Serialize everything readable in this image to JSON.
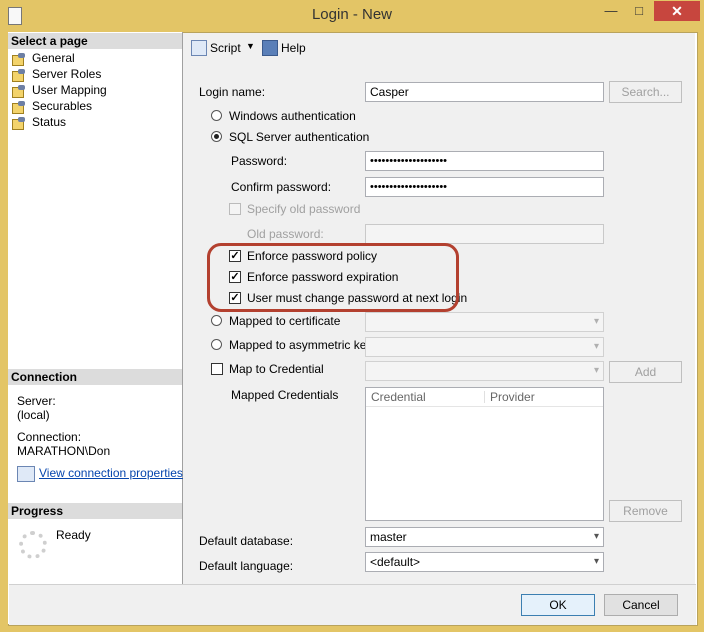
{
  "window": {
    "title": "Login - New",
    "minimize": "—",
    "maximize": "□",
    "close": "✕"
  },
  "sidebar": {
    "select_page_header": "Select a page",
    "pages": [
      "General",
      "Server Roles",
      "User Mapping",
      "Securables",
      "Status"
    ],
    "connection_header": "Connection",
    "server_label": "Server:",
    "server_value": "(local)",
    "connection_label": "Connection:",
    "connection_value": "MARATHON\\Don",
    "view_props_link": "View connection properties",
    "progress_header": "Progress",
    "progress_status": "Ready"
  },
  "toolbar": {
    "script_label": "Script",
    "help_label": "Help"
  },
  "form": {
    "login_name_label": "Login name:",
    "login_name_value": "Casper",
    "search_button": "Search...",
    "windows_auth": "Windows authentication",
    "sql_auth": "SQL Server authentication",
    "password_label": "Password:",
    "password_value": "••••••••••••••••••••",
    "confirm_label": "Confirm password:",
    "confirm_value": "••••••••••••••••••••",
    "specify_old": "Specify old password",
    "old_password_label": "Old password:",
    "enforce_policy": "Enforce password policy",
    "enforce_expiration": "Enforce password expiration",
    "must_change": "User must change password at next login",
    "mapped_cert": "Mapped to certificate",
    "mapped_asym": "Mapped to asymmetric key",
    "map_credential": "Map to Credential",
    "add_button": "Add",
    "mapped_credentials_label": "Mapped Credentials",
    "grid_headers": [
      "Credential",
      "Provider"
    ],
    "remove_button": "Remove",
    "default_db_label": "Default database:",
    "default_db_value": "master",
    "default_lang_label": "Default language:",
    "default_lang_value": "<default>"
  },
  "footer": {
    "ok": "OK",
    "cancel": "Cancel"
  }
}
